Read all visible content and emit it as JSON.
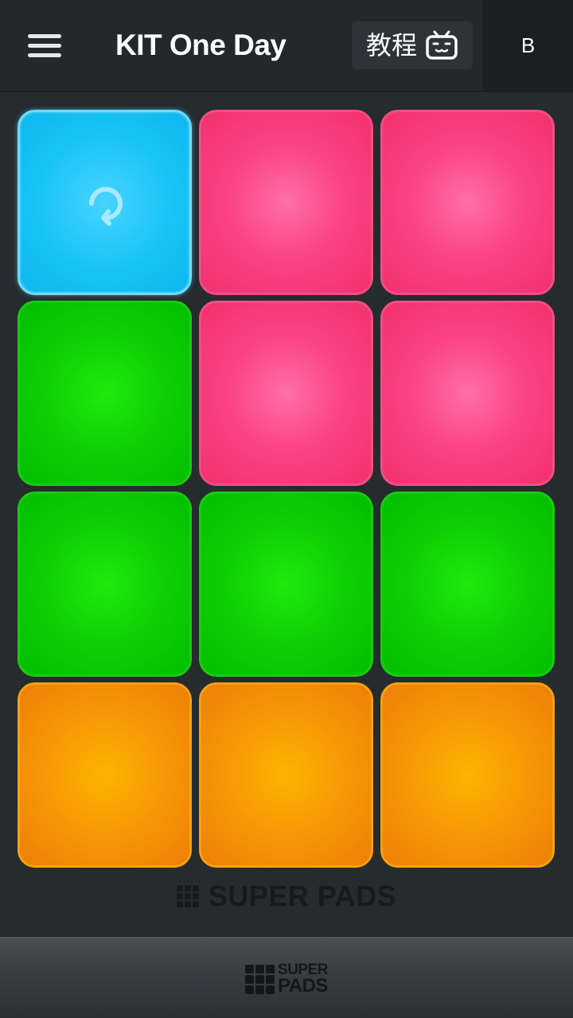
{
  "header": {
    "kit_title": "KIT One Day",
    "tutorial_label": "教程",
    "user_initial": "B"
  },
  "pads": [
    {
      "color": "blue",
      "icon": "loop-icon"
    },
    {
      "color": "pink"
    },
    {
      "color": "pink"
    },
    {
      "color": "green"
    },
    {
      "color": "pink"
    },
    {
      "color": "pink"
    },
    {
      "color": "green"
    },
    {
      "color": "green"
    },
    {
      "color": "green"
    },
    {
      "color": "orange"
    },
    {
      "color": "orange"
    },
    {
      "color": "orange"
    }
  ],
  "brand": {
    "watermark_text": "SUPER PADS",
    "banner_word_1": "SUPER",
    "banner_word_2": "PADS"
  },
  "colors": {
    "blue_pad": "#18c4f7",
    "pink_pad": "#fb4485",
    "green_pad": "#10d104",
    "orange_pad": "#f79a06",
    "background": "#262b2e"
  }
}
